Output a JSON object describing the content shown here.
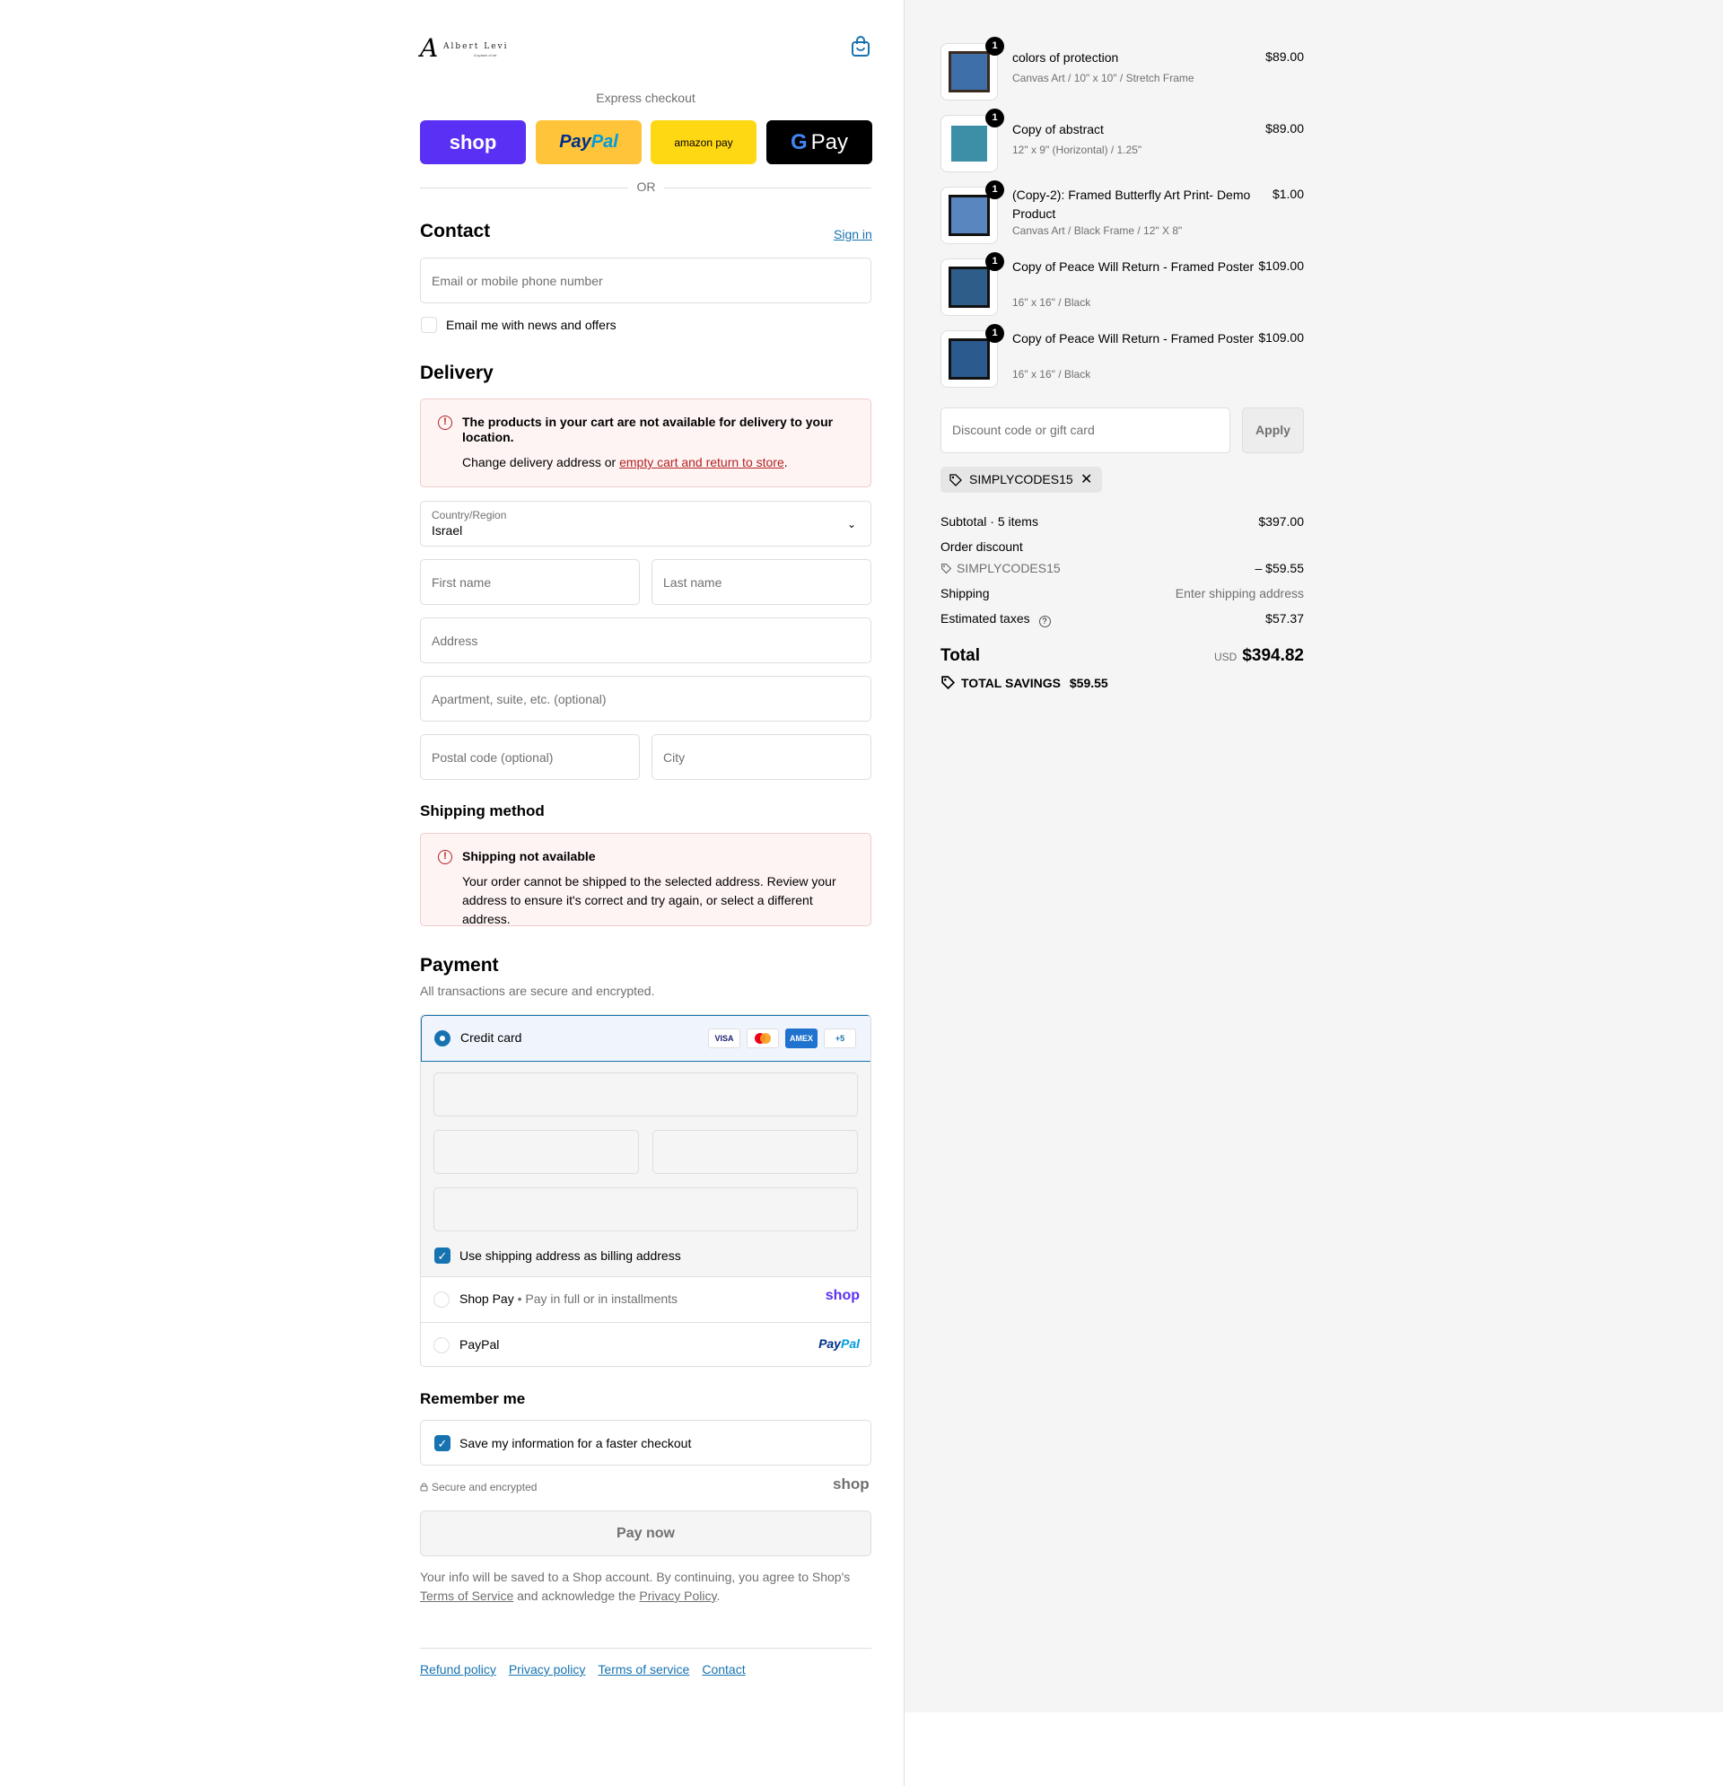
{
  "header": {
    "logo_letter": "A",
    "logo_name": "Albert Levi",
    "logo_tagline": "A splash of art",
    "cart_icon": "shopping-bag-icon"
  },
  "express": {
    "title": "Express checkout",
    "shop_label": "shop",
    "paypal_a": "Pay",
    "paypal_b": "Pal",
    "amazon_label": "amazon pay",
    "gpay_g": "G",
    "gpay_label": "Pay",
    "or": "OR"
  },
  "contact": {
    "title": "Contact",
    "sign_in": "Sign in",
    "email_placeholder": "Email or mobile phone number",
    "news_label": "Email me with news and offers"
  },
  "delivery": {
    "title": "Delivery",
    "alert_title": "The products in your cart are not available for delivery to your location.",
    "alert_body_prefix": "Change delivery address or ",
    "alert_link": "empty cart and return to store",
    "alert_body_suffix": ".",
    "country_label": "Country/Region",
    "country_value": "Israel",
    "first_name": "First name",
    "last_name": "Last name",
    "address": "Address",
    "apartment": "Apartment, suite, etc. (optional)",
    "postal": "Postal code (optional)",
    "city": "City"
  },
  "shipping_method": {
    "title": "Shipping method",
    "alert_title": "Shipping not available",
    "alert_body": "Your order cannot be shipped to the selected address. Review your address to ensure it's correct and try again, or select a different address."
  },
  "payment": {
    "title": "Payment",
    "subtitle": "All transactions are secure and encrypted.",
    "credit_card": "Credit card",
    "cards": [
      "VISA",
      "",
      "AMEX",
      "+5"
    ],
    "billing_label": "Use shipping address as billing address",
    "shop_pay": "Shop Pay",
    "shop_pay_sub": " • Pay in full or in installments",
    "shop_pay_logo": "shop",
    "paypal": "PayPal",
    "paypal_logo_a": "Pay",
    "paypal_logo_b": "Pal"
  },
  "remember": {
    "title": "Remember me",
    "save_label": "Save my information for a faster checkout",
    "secure": "Secure and encrypted",
    "shop_logo": "shop"
  },
  "pay_now": "Pay now",
  "consent": {
    "prefix": "Your info will be saved to a Shop account. By continuing, you agree to Shop's ",
    "terms": "Terms of Service",
    "middle": " and acknowledge the ",
    "privacy": "Privacy Policy",
    "suffix": "."
  },
  "footer": [
    "Refund policy",
    "Privacy policy",
    "Terms of service",
    "Contact"
  ],
  "items": [
    {
      "qty": "1",
      "name": "colors of protection",
      "variant": "Canvas Art / 10\" x 10\" / Stretch Frame",
      "price": "$89.00"
    },
    {
      "qty": "1",
      "name": "Copy of abstract",
      "variant": "12\" x 9\" (Horizontal) / 1.25\"",
      "price": "$89.00"
    },
    {
      "qty": "1",
      "name": "(Copy-2): Framed Butterfly Art Print- Demo Product",
      "variant": "Canvas Art / Black Frame / 12\" X 8\"",
      "price": "$1.00"
    },
    {
      "qty": "1",
      "name": "Copy of Peace Will Return - Framed Poster",
      "variant": "16\" x 16\" / Black",
      "price": "$109.00"
    },
    {
      "qty": "1",
      "name": "Copy of Peace Will Return - Framed Poster",
      "variant": "16\" x 16\" / Black",
      "price": "$109.00"
    }
  ],
  "discount": {
    "placeholder": "Discount code or gift card",
    "apply": "Apply",
    "code": "SIMPLYCODES15"
  },
  "summary": {
    "subtotal_label": "Subtotal · 5 items",
    "subtotal": "$397.00",
    "order_discount": "Order discount",
    "code": "SIMPLYCODES15",
    "discount_value": "– $59.55",
    "shipping_label": "Shipping",
    "shipping_value": "Enter shipping address",
    "taxes_label": "Estimated taxes",
    "taxes_value": "$57.37",
    "total_label": "Total",
    "currency": "USD",
    "total": "$394.82",
    "savings_label": "TOTAL SAVINGS",
    "savings_value": "$59.55"
  },
  "colors": {
    "accent": "#1773b0",
    "error": "#b22222",
    "shop_purple": "#5a31f4",
    "paypal_yellow": "#ffc439",
    "amazon_yellow": "#ffd814"
  }
}
